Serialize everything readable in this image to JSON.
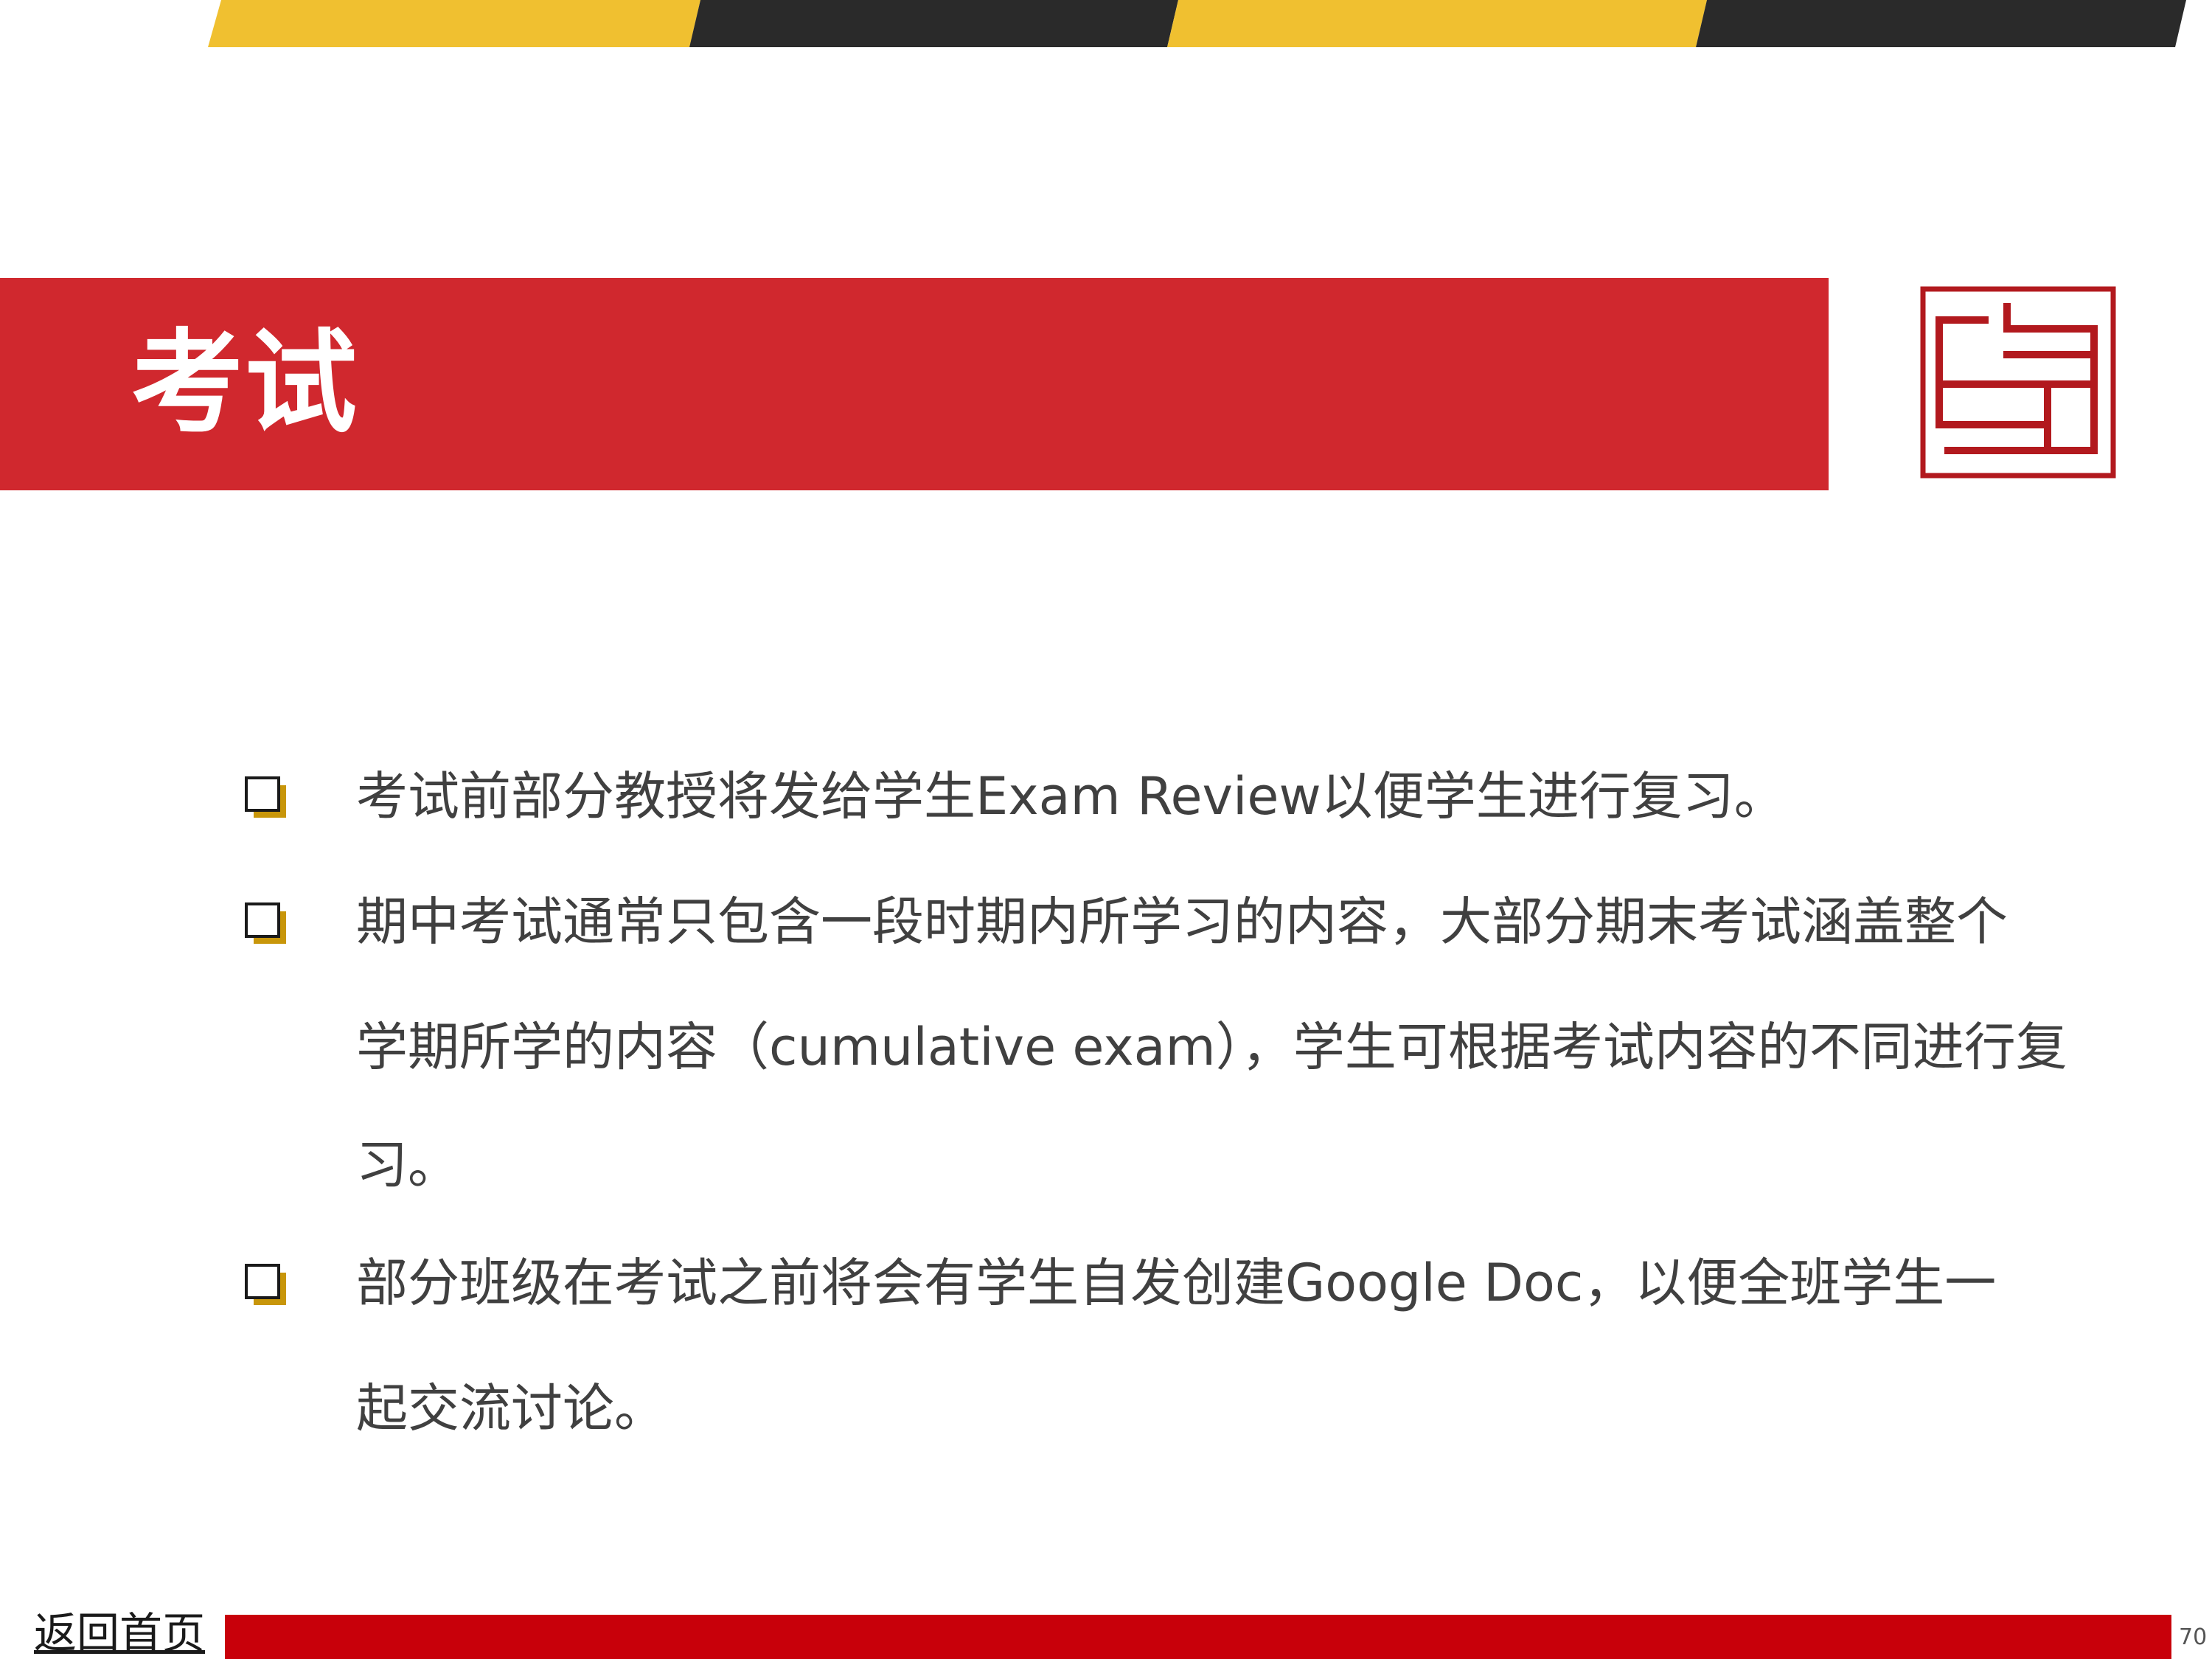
{
  "title": "考试",
  "bullets": [
    {
      "lines": [
        "考试前部分教授将发给学生Exam Review以便学生进行复习。"
      ]
    },
    {
      "lines": [
        "期中考试通常只包含一段时期内所学习的内容，大部分期末考试涵盖整个",
        "学期所学的内容（cumulative exam），学生可根据考试内容的不同进行复",
        "习。"
      ]
    },
    {
      "lines": [
        "部分班级在考试之前将会有学生自发创建Google Doc，以便全班学生一",
        "起交流讨论。"
      ]
    }
  ],
  "footer": {
    "home_link": "返回首页",
    "page_number": "70"
  },
  "logo": {
    "icon": "seal-logo-icon"
  },
  "colors": {
    "title_bar": "#d0282e",
    "stripe_yellow": "#f0c030",
    "stripe_dark": "#2a2a2a",
    "bullet_gold": "#c8960a",
    "footer_bar": "#c8000a",
    "body_text": "#404040"
  }
}
